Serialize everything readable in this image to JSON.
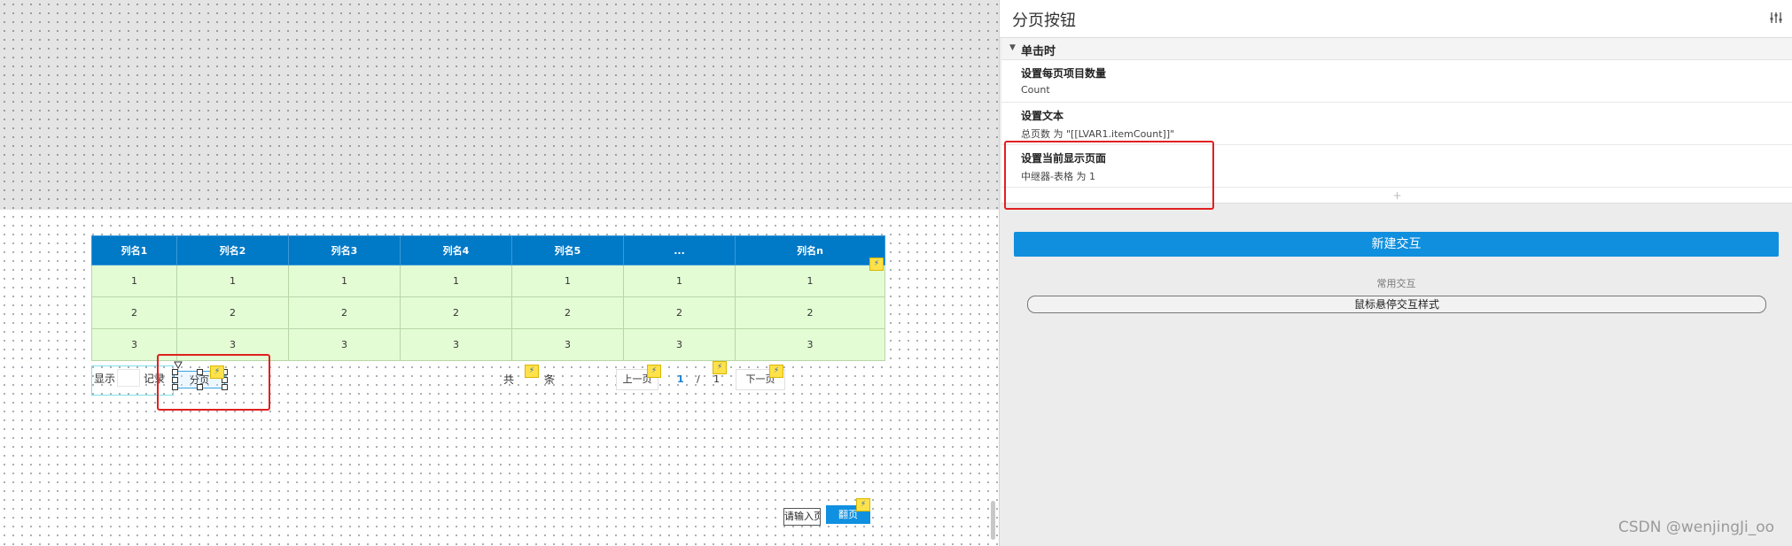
{
  "canvas": {
    "table": {
      "headers": [
        "列名1",
        "列名2",
        "列名3",
        "列名4",
        "列名5",
        "...",
        "列名n"
      ],
      "rows": [
        [
          "1",
          "1",
          "1",
          "1",
          "1",
          "1",
          "1"
        ],
        [
          "2",
          "2",
          "2",
          "2",
          "2",
          "2",
          "2"
        ],
        [
          "3",
          "3",
          "3",
          "3",
          "3",
          "3",
          "3"
        ]
      ]
    },
    "pagination": {
      "show_label": "显示",
      "records_label": "记录",
      "page_button": "分页",
      "total_label": "共",
      "items_label": "条",
      "prev_button": "上一页",
      "current_page": "1",
      "separator": "/",
      "total_pages": "1",
      "next_button": "下一页",
      "jump_input_placeholder": "请输入页",
      "jump_button": "翻页"
    },
    "interaction_badge": "⚡"
  },
  "panel": {
    "title": "分页按钮",
    "event_label": "单击时",
    "actions": [
      {
        "title": "设置每页项目数量",
        "detail": "Count"
      },
      {
        "title": "设置文本",
        "detail": "总页数 为 \"[[LVAR1.itemCount]]\""
      },
      {
        "title": "设置当前显示页面",
        "detail": "中继器-表格 为 1"
      }
    ],
    "add_symbol": "+",
    "new_interaction_button": "新建交互",
    "common_interactions_label": "常用交互",
    "hover_style_button": "鼠标悬停交互样式"
  },
  "watermark": "CSDN @wenjingJi_oo",
  "colors": {
    "table_header": "#0079c7",
    "table_cell": "#e3fcd4",
    "primary_button": "#0f8fde",
    "highlight_red": "#e02020",
    "interaction_badge": "#ffe14a"
  }
}
